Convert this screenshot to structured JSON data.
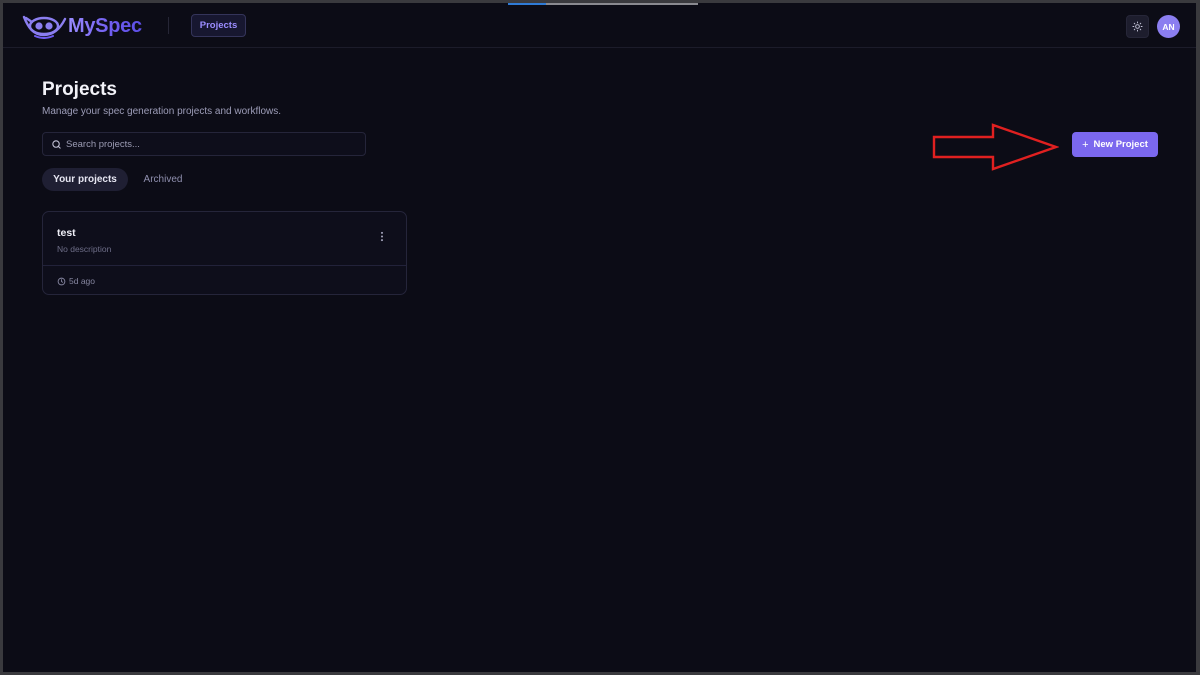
{
  "app": {
    "name": "MySpec",
    "nav_projects": "Projects",
    "user_initials": "AN"
  },
  "page": {
    "title": "Projects",
    "subtitle": "Manage your spec generation projects and workflows.",
    "search_placeholder": "Search projects...",
    "new_project_label": "New Project"
  },
  "tabs": [
    {
      "label": "Your projects",
      "active": true
    },
    {
      "label": "Archived",
      "active": false
    }
  ],
  "projects": [
    {
      "name": "test",
      "description": "No description",
      "updated": "5d ago"
    }
  ],
  "icons": {
    "logo": "mascot-eyes-icon",
    "theme": "sun-icon",
    "search": "search-icon",
    "menu": "vertical-dots-icon",
    "clock": "clock-icon",
    "plus": "plus-icon"
  },
  "colors": {
    "background": "#0c0c16",
    "accent": "#7b68ee",
    "annotation": "#e02020"
  }
}
